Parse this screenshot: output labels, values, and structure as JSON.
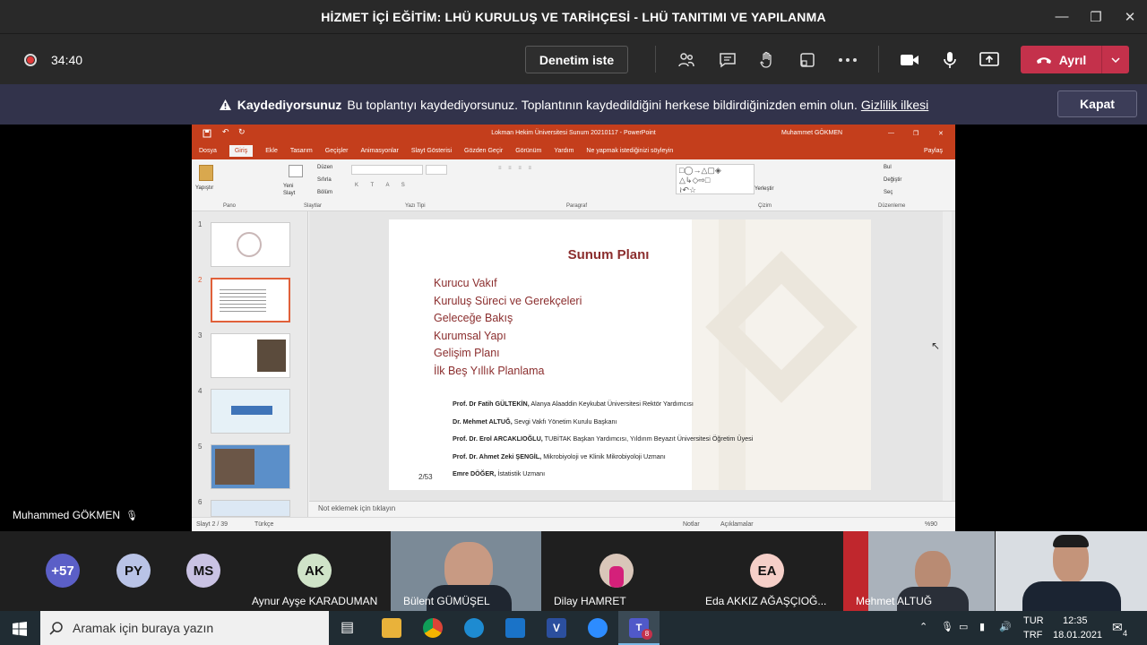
{
  "window": {
    "title": "HİZMET İÇİ EĞİTİM: LHÜ KURULUŞ VE TARİHÇESİ - LHÜ TANITIMI VE YAPILANMA"
  },
  "meeting": {
    "timer": "34:40",
    "control_button": "Denetim iste",
    "leave_label": "Ayrıl"
  },
  "recording_banner": {
    "bold": "Kaydediyorsunuz",
    "text": "Bu toplantıyı kaydediyorsunuz. Toplantının kaydedildiğini herkese bildirdiğinizden emin olun.",
    "link": "Gizlilik ilkesi",
    "dismiss": "Kapat"
  },
  "powerpoint": {
    "title": "Lokman Hekim Üniversitesi Sunum 20210117  -  PowerPoint",
    "user": "Muhammet GÖKMEN",
    "share": "Paylaş",
    "tabs": [
      "Dosya",
      "Giriş",
      "Ekle",
      "Tasarım",
      "Geçişler",
      "Animasyonlar",
      "Slayt Gösterisi",
      "Gözden Geçir",
      "Görünüm",
      "Yardım"
    ],
    "tell_me": "Ne yapmak istediğinizi söyleyin",
    "ribbon_groups": [
      "Pano",
      "Slaytlar",
      "Yazı Tipi",
      "Paragraf",
      "Çizim",
      "Düzenleme"
    ],
    "ribbon_labels": {
      "paste": "Yapıştır",
      "new_slide": "Yeni Slayt",
      "layout": "Düzen",
      "reset": "Sıfırla",
      "section": "Bölüm",
      "arrange": "Yerleştir",
      "find": "Bul",
      "replace": "Değiştir",
      "select": "Seç"
    },
    "thumbnails": [
      "1",
      "2",
      "3",
      "4",
      "5",
      "6"
    ],
    "slide": {
      "title": "Sunum Planı",
      "agenda": [
        "Kurucu Vakıf",
        "Kuruluş Süreci ve Gerekçeleri",
        "Geleceğe Bakış",
        "Kurumsal Yapı",
        "Gelişim Planı",
        "İlk Beş Yıllık Planlama"
      ],
      "people": [
        {
          "name": "Prof. Dr Fatih GÜLTEKİN,",
          "role": "Alanya Alaaddin Keykubat Üniversitesi Rektör Yardımcısı"
        },
        {
          "name": "Dr. Mehmet ALTUĞ,",
          "role": "Sevgi Vakfı Yönetim Kurulu Başkanı"
        },
        {
          "name": "Prof. Dr. Erol ARCAKLIOĞLU,",
          "role": "TUBİTAK Başkan Yardımcısı, Yıldırım Beyazıt Üniversitesi Öğretim Üyesi"
        },
        {
          "name": "Prof. Dr. Ahmet Zeki ŞENGİL,",
          "role": "Mikrobiyoloji ve Klinik Mikrobiyoloji Uzmanı"
        },
        {
          "name": "Emre DÖĞER,",
          "role": "İstatistik Uzmanı"
        }
      ],
      "page": "2/53"
    },
    "notes_placeholder": "Not eklemek için tıklayın",
    "status": {
      "slide": "Slayt 2 / 39",
      "lang": "Türkçe",
      "notes": "Notlar",
      "comments": "Açıklamalar",
      "zoom": "%90"
    }
  },
  "presenter": "Muhammed GÖKMEN",
  "participants": {
    "overflow": "+57",
    "avatars": [
      {
        "initials": "PY",
        "color": "#b9c3e6"
      },
      {
        "initials": "MS",
        "color": "#c9c2e3"
      }
    ],
    "tiles": [
      {
        "initials": "AK",
        "name": "Aynur Ayşe KARADUMAN",
        "color": "#cfe3c8"
      },
      {
        "name": "Bülent GÜMÜŞEL"
      },
      {
        "name": "Dilay HAMRET"
      },
      {
        "initials": "EA",
        "name": "Eda AKKIZ AĞAŞÇIOĞ...",
        "color": "#f5cfc8"
      },
      {
        "name": "Mehmet ALTUĞ"
      },
      {
        "name": ""
      }
    ]
  },
  "taskbar": {
    "search_placeholder": "Aramak için buraya yazın",
    "lang1": "TUR",
    "lang2": "TRF",
    "time": "12:35",
    "date": "18.01.2021",
    "notif": "4",
    "teams_badge": "8"
  }
}
